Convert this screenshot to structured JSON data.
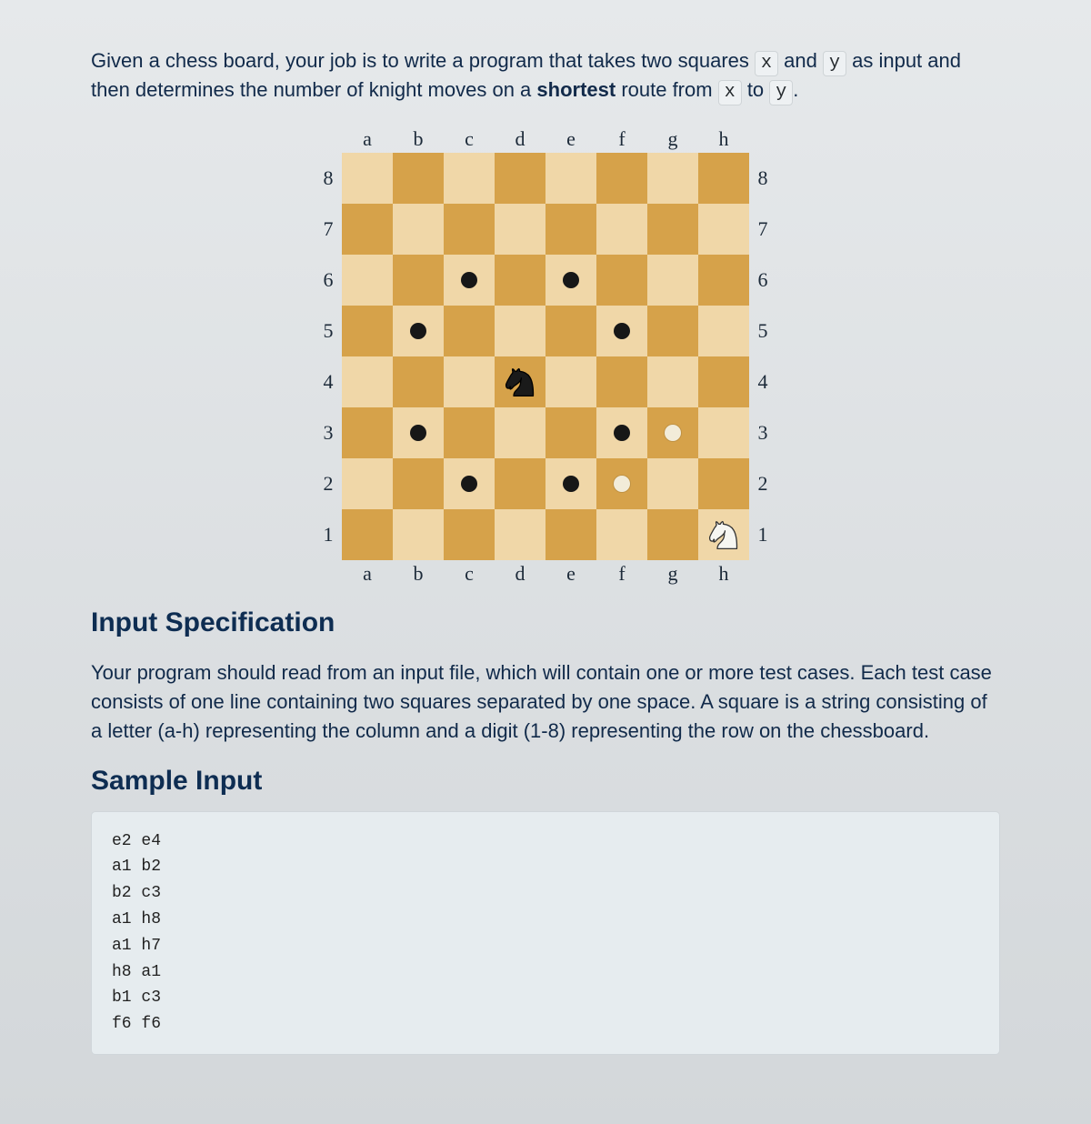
{
  "intro": {
    "p1a": "Given a chess board, your job is to write a program that takes two squares ",
    "code_x": "x",
    "p1b": " and ",
    "code_y": "y",
    "p1c": " as input and then determines the number of knight moves on a ",
    "bold": "shortest",
    "p1d": " route from ",
    "code_x2": "x",
    "p1e": " to ",
    "code_y2": "y",
    "p1f": "."
  },
  "board": {
    "files": [
      "a",
      "b",
      "c",
      "d",
      "e",
      "f",
      "g",
      "h"
    ],
    "ranks": [
      "8",
      "7",
      "6",
      "5",
      "4",
      "3",
      "2",
      "1"
    ],
    "black_knight": "d4",
    "white_knight": "h1",
    "dark_dots": [
      "c6",
      "e6",
      "b5",
      "f5",
      "b3",
      "f3",
      "c2",
      "e2"
    ],
    "light_dots": [
      "g3",
      "f2"
    ]
  },
  "sections": {
    "input_spec_title": "Input Specification",
    "input_spec_text": "Your program should read from an input file, which will contain one or more test cases. Each test case consists of one line containing two squares separated by one space. A square is a string consisting of a letter (a-h) representing the column and a digit (1-8) representing the row on the chessboard.",
    "sample_input_title": "Sample Input",
    "sample_input": "e2 e4\na1 b2\nb2 c3\na1 h8\na1 h7\nh8 a1\nb1 c3\nf6 f6"
  }
}
